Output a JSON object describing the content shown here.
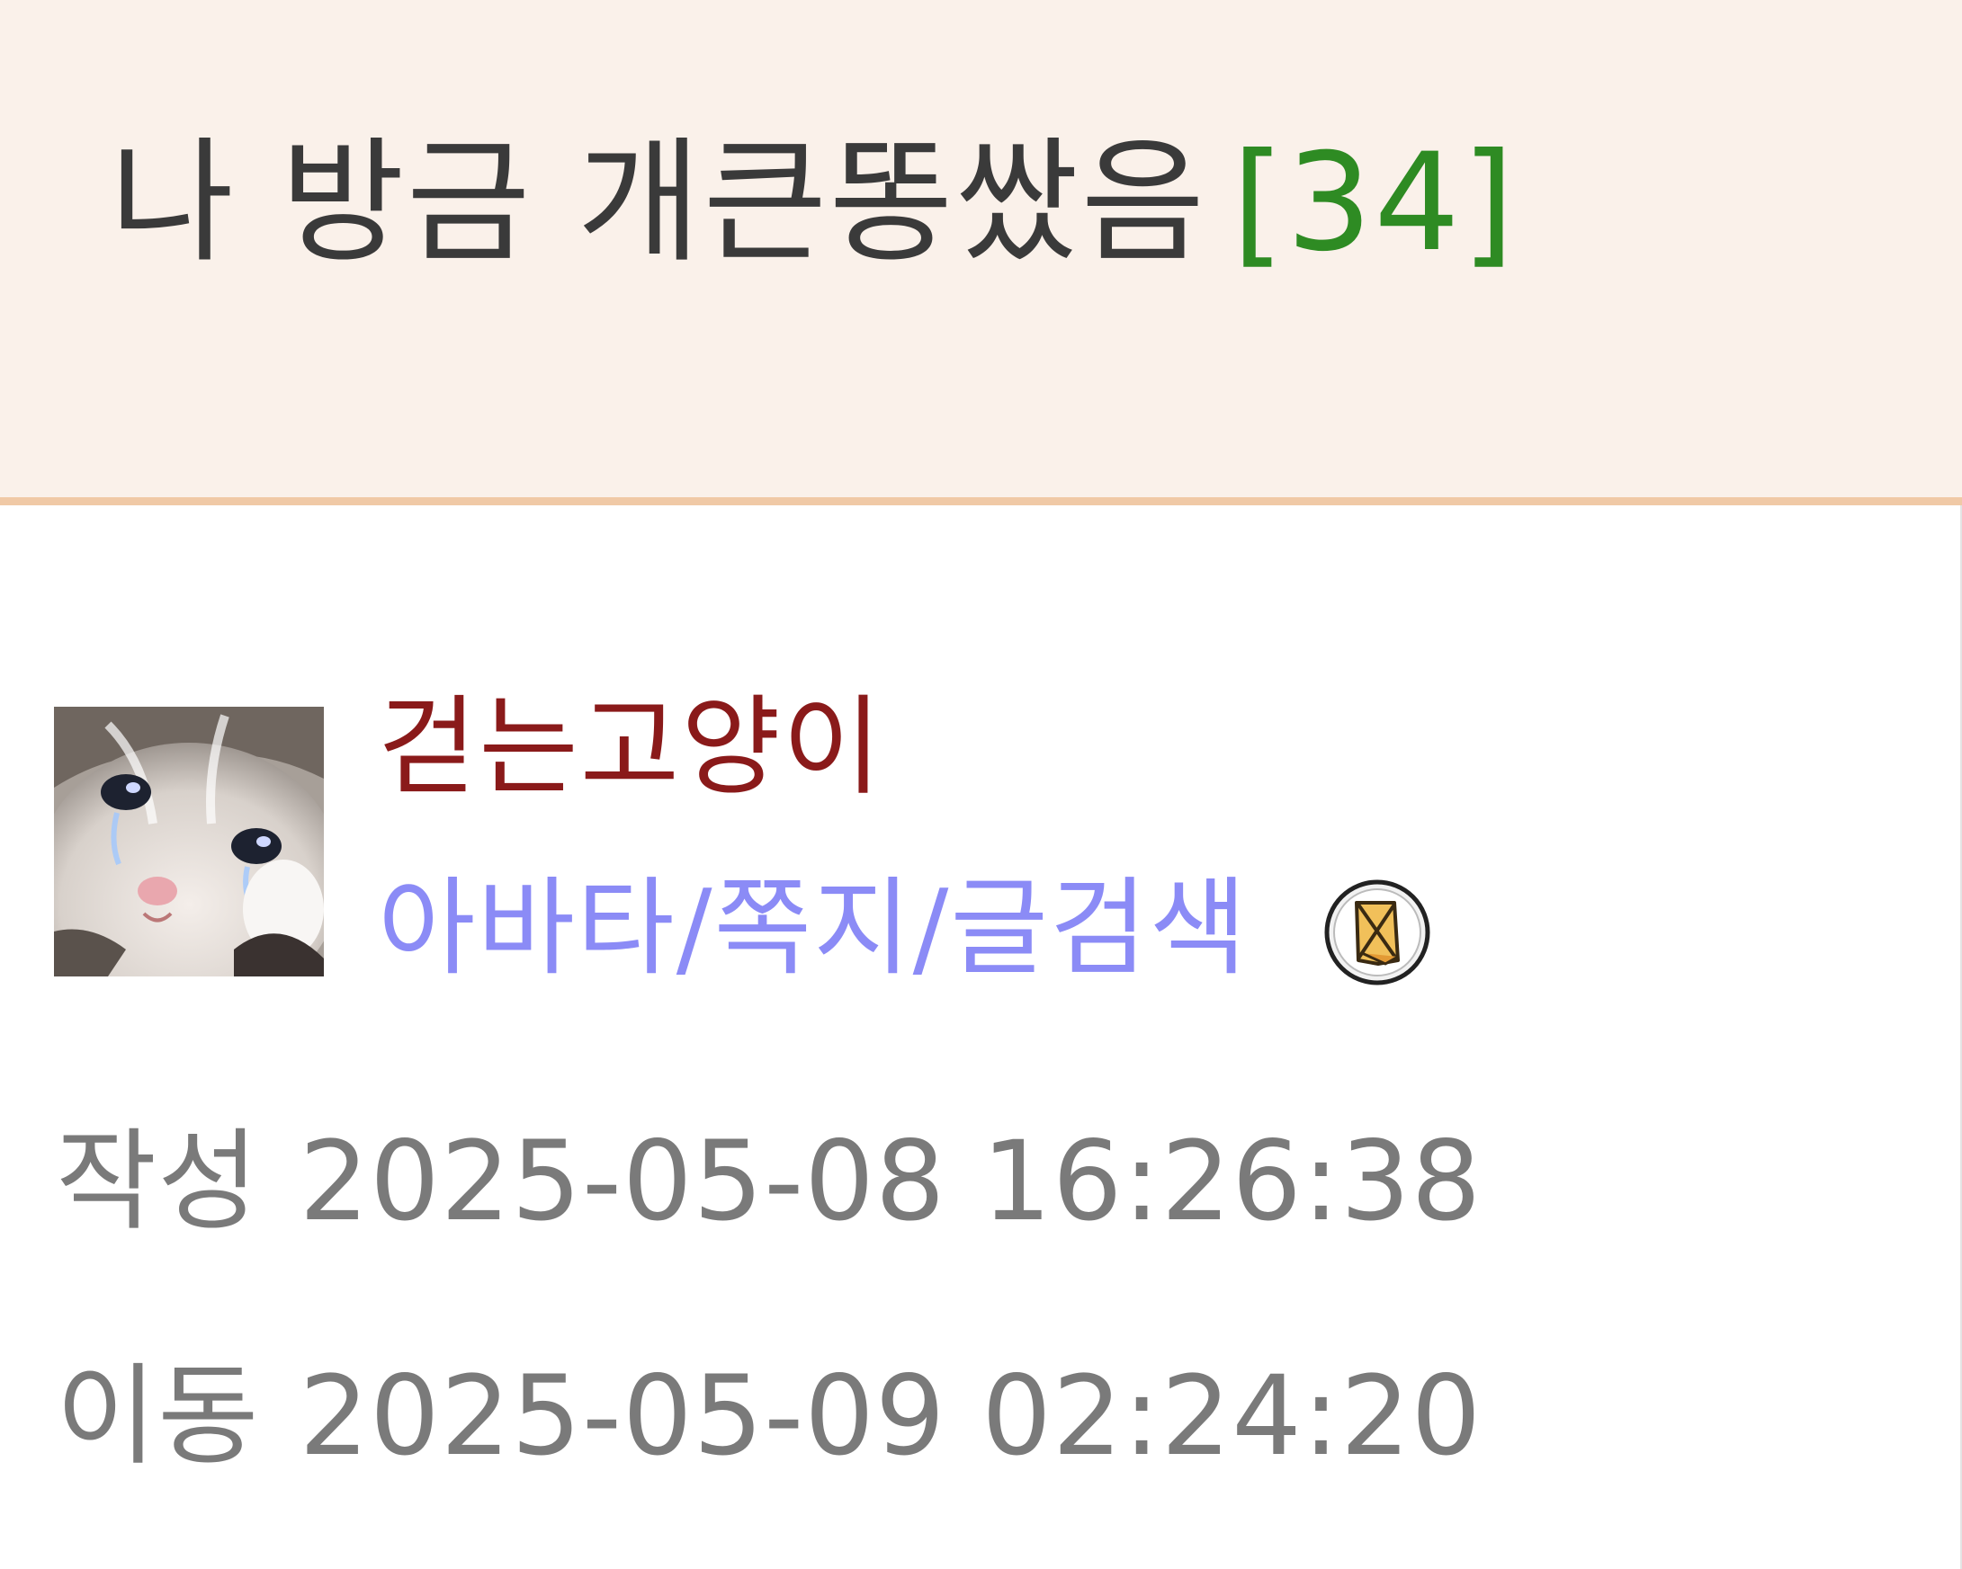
{
  "post": {
    "title": "나 방금 개큰똥쌌음",
    "comment_count": "[34]"
  },
  "author": {
    "name": "걷는고양이",
    "links": {
      "avatar": "아바타",
      "message": "쪽지",
      "search": "글검색",
      "separator": "/"
    },
    "avatar_icon": "crying-cat-avatar",
    "badge_icon": "level-badge-icon"
  },
  "meta": {
    "written_label": "작성",
    "written_value": "2025-05-08 16:26:38",
    "moved_label": "이동",
    "moved_value": "2025-05-09 02:24:20"
  },
  "colors": {
    "title_bg": "#faf1ea",
    "title_border": "#f0c9a6",
    "title_text": "#3a3a3a",
    "comment_count": "#2e8b23",
    "username": "#8a1a1a",
    "links": "#8b8bf6",
    "meta_text": "#7a7a7a"
  }
}
